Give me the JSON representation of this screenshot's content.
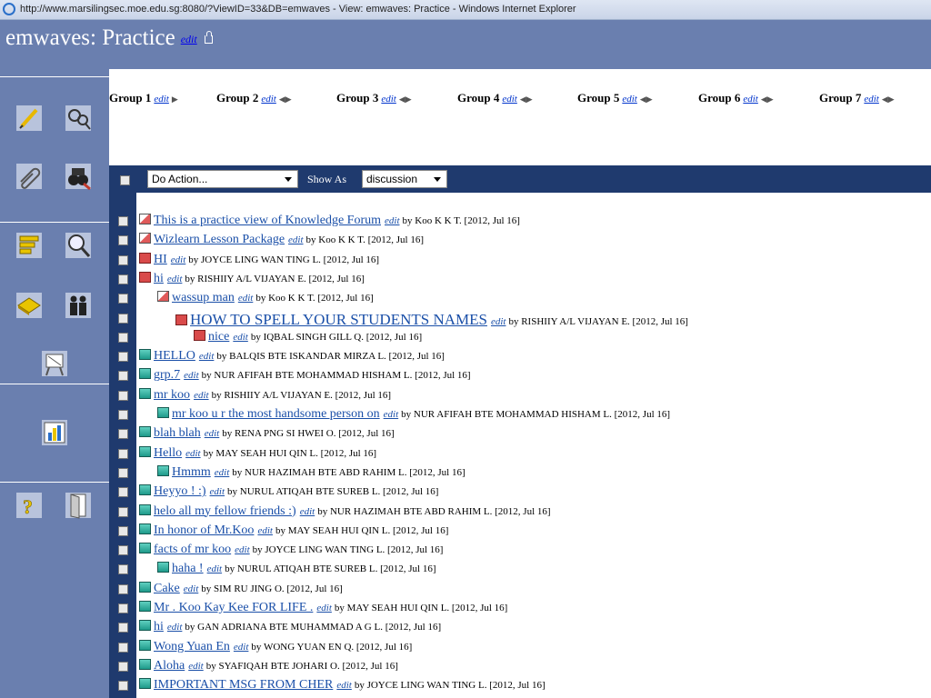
{
  "window": {
    "title": "http://www.marsilingsec.moe.edu.sg:8080/?ViewID=33&DB=emwaves - View: emwaves: Practice - Windows Internet Explorer"
  },
  "header": {
    "title": "emwaves: Practice",
    "edit_label": "edit"
  },
  "groups": [
    {
      "label": "Group 1",
      "edit": "edit",
      "arrow": "▶"
    },
    {
      "label": "Group 2",
      "edit": "edit",
      "arrow": "◀▶"
    },
    {
      "label": "Group 3",
      "edit": "edit",
      "arrow": "◀▶"
    },
    {
      "label": "Group 4",
      "edit": "edit",
      "arrow": "◀▶"
    },
    {
      "label": "Group 5",
      "edit": "edit",
      "arrow": "◀▶"
    },
    {
      "label": "Group 6",
      "edit": "edit",
      "arrow": "◀▶"
    },
    {
      "label": "Group 7",
      "edit": "edit",
      "arrow": "◀▶"
    }
  ],
  "toolbar": {
    "action_select": "Do Action...",
    "show_as_label": "Show As",
    "show_as_select": "discussion"
  },
  "sidebar_icons": [
    "pencil-icon",
    "search-links-icon",
    "paperclip-icon",
    "binoculars-icon",
    "scaffold-icon",
    "magnifier-icon",
    "book-icon",
    "people-icon",
    "easel-icon",
    "chart-icon",
    "help-icon",
    "exit-door-icon"
  ],
  "notes": [
    {
      "indent": 0,
      "icon": "pink",
      "title": "This is a practice view of Knowledge Forum",
      "edit": "edit",
      "by": "by Koo K K T. [2012, Jul 16]"
    },
    {
      "indent": 0,
      "icon": "pink",
      "title": "Wizlearn Lesson Package",
      "edit": "edit",
      "by": "by Koo K K T. [2012, Jul 16]"
    },
    {
      "indent": 0,
      "icon": "red",
      "title": "HI",
      "edit": "edit",
      "by": "by JOYCE LING WAN TING L. [2012, Jul 16]"
    },
    {
      "indent": 0,
      "icon": "red",
      "title": "hi",
      "edit": "edit",
      "by": "by RISHIIY A/L VIJAYAN E. [2012, Jul 16]"
    },
    {
      "indent": 1,
      "icon": "pink",
      "title": "wassup man",
      "edit": "edit",
      "by": "by Koo K K T. [2012, Jul 16]"
    },
    {
      "indent": 2,
      "icon": "red",
      "title": "HOW TO SPELL YOUR STUDENTS NAMES",
      "edit": "edit",
      "by": "by RISHIIY A/L VIJAYAN E. [2012, Jul 16]",
      "big": true
    },
    {
      "indent": 3,
      "icon": "red",
      "title": "nice",
      "edit": "edit",
      "by": "by IQBAL SINGH GILL Q. [2012, Jul 16]"
    },
    {
      "indent": 0,
      "icon": "green",
      "title": "HELLO",
      "edit": "edit",
      "by": "by BALQIS BTE ISKANDAR MIRZA L. [2012, Jul 16]"
    },
    {
      "indent": 0,
      "icon": "green",
      "title": "grp.7",
      "edit": "edit",
      "by": "by NUR AFIFAH BTE MOHAMMAD HISHAM L. [2012, Jul 16]"
    },
    {
      "indent": 0,
      "icon": "green",
      "title": "mr koo",
      "edit": "edit",
      "by": "by RISHIIY A/L VIJAYAN E. [2012, Jul 16]"
    },
    {
      "indent": 1,
      "icon": "green",
      "title": "mr koo u r the most handsome person on",
      "edit": "edit",
      "by": "by NUR AFIFAH BTE MOHAMMAD HISHAM L. [2012, Jul 16]"
    },
    {
      "indent": 0,
      "icon": "green",
      "title": "blah blah",
      "edit": "edit",
      "by": "by RENA PNG SI HWEI O. [2012, Jul 16]"
    },
    {
      "indent": 0,
      "icon": "green",
      "title": "Hello",
      "edit": "edit",
      "by": "by MAY SEAH HUI QIN L. [2012, Jul 16]"
    },
    {
      "indent": 1,
      "icon": "green",
      "title": "Hmmm",
      "edit": "edit",
      "by": "by NUR HAZIMAH BTE ABD RAHIM L. [2012, Jul 16]"
    },
    {
      "indent": 0,
      "icon": "green",
      "title": "Heyyo ! :)",
      "edit": "edit",
      "by": "by NURUL ATIQAH BTE SUREB L. [2012, Jul 16]"
    },
    {
      "indent": 0,
      "icon": "green",
      "title": "helo all my fellow friends :)",
      "edit": "edit",
      "by": "by NUR HAZIMAH BTE ABD RAHIM L. [2012, Jul 16]"
    },
    {
      "indent": 0,
      "icon": "green",
      "title": "In honor of Mr.Koo",
      "edit": "edit",
      "by": "by MAY SEAH HUI QIN L. [2012, Jul 16]"
    },
    {
      "indent": 0,
      "icon": "green",
      "title": "facts of mr koo",
      "edit": "edit",
      "by": "by JOYCE LING WAN TING L. [2012, Jul 16]"
    },
    {
      "indent": 1,
      "icon": "green",
      "title": "haha !",
      "edit": "edit",
      "by": "by NURUL ATIQAH BTE SUREB L. [2012, Jul 16]"
    },
    {
      "indent": 0,
      "icon": "green",
      "title": "Cake",
      "edit": "edit",
      "by": "by SIM RU JING O. [2012, Jul 16]"
    },
    {
      "indent": 0,
      "icon": "green",
      "title": "Mr . Koo Kay Kee FOR LIFE .",
      "edit": "edit",
      "by": "by MAY SEAH HUI QIN L. [2012, Jul 16]"
    },
    {
      "indent": 0,
      "icon": "green",
      "title": "hi",
      "edit": "edit",
      "by": "by GAN ADRIANA BTE MUHAMMAD A G L. [2012, Jul 16]"
    },
    {
      "indent": 0,
      "icon": "green",
      "title": "Wong Yuan En",
      "edit": "edit",
      "by": "by WONG YUAN EN Q. [2012, Jul 16]"
    },
    {
      "indent": 0,
      "icon": "green",
      "title": "Aloha",
      "edit": "edit",
      "by": "by SYAFIQAH BTE JOHARI O. [2012, Jul 16]"
    },
    {
      "indent": 0,
      "icon": "green",
      "title": "IMPORTANT MSG FROM CHER",
      "edit": "edit",
      "by": "by JOYCE LING WAN TING L. [2012, Jul 16]"
    }
  ]
}
